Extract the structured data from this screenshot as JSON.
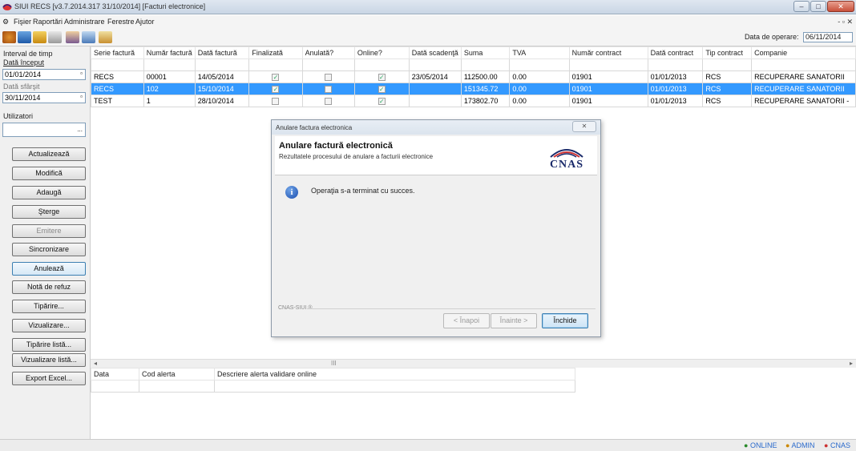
{
  "window": {
    "title": "SIUI RECS [v3.7.2014.317  31/10/2014]  [Facturi electronice]",
    "min": "–",
    "max": "□",
    "close": "✕"
  },
  "menu": {
    "items": [
      "Fişier",
      "Raportări",
      "Administrare",
      "Ferestre",
      "Ajutor"
    ],
    "mdi": "- ▫ ✕"
  },
  "toolbar": {
    "op_label": "Data de operare:",
    "op_value": "06/11/2014"
  },
  "filters": {
    "interval_label": "Interval de timp",
    "start_label": "Dată început",
    "start_value": "01/01/2014",
    "end_label": "Dată sfârşit",
    "end_value": "30/11/2014",
    "users_label": "Utilizatori",
    "dd": "▫",
    "more": "..."
  },
  "buttons": [
    "Actualizează",
    "Modifică",
    "Adaugă",
    "Şterge",
    "Emitere",
    "Sincronizare",
    "Anulează",
    "Notă de refuz",
    "Tipărire...",
    "Vizualizare...",
    "Tipărire listă...",
    "Vizualizare listă...",
    "Export Excel..."
  ],
  "table": {
    "headers": [
      "Serie factură",
      "Număr factură",
      "Dată factură",
      "Finalizată",
      "Anulată?",
      "Online?",
      "Dată scadenţă",
      "Suma",
      "TVA",
      "Număr contract",
      "Dată contract",
      "Tip contract",
      "Companie"
    ],
    "rows": [
      [
        "RECS",
        "00001",
        "14/05/2014",
        true,
        false,
        true,
        "23/05/2014",
        "112500.00",
        "0.00",
        "01901",
        "01/01/2013",
        "RCS",
        "RECUPERARE SANATORII"
      ],
      [
        "RECS",
        "102",
        "15/10/2014",
        true,
        false,
        true,
        "",
        "151345.72",
        "0.00",
        "01901",
        "01/01/2013",
        "RCS",
        "RECUPERARE SANATORII"
      ],
      [
        "TEST",
        "1",
        "28/10/2014",
        false,
        false,
        true,
        "",
        "173802.70",
        "0.00",
        "01901",
        "01/01/2013",
        "RCS",
        "RECUPERARE SANATORII -"
      ]
    ],
    "selected": 1
  },
  "alerts": {
    "headers": [
      "Data",
      "Cod alerta",
      "Descriere alerta validare online"
    ]
  },
  "scroll": {
    "left": "◂",
    "right": "▸",
    "thumb": "III"
  },
  "status": {
    "online": "ONLINE",
    "user": "ADMIN",
    "cnas": "CNAS"
  },
  "dialog": {
    "title": "Anulare factura electronica",
    "close": "✕",
    "heading": "Anulare factură electronică",
    "subtitle": "Rezultatele procesului de anulare a facturii electronice",
    "logo": "CNAS",
    "icon": "i",
    "message": "Operaţia s-a terminat cu succes.",
    "footer": "CNAS-SIUI ®",
    "back": "< Înapoi",
    "next": "Înainte >",
    "close_btn": "Închide"
  },
  "colors": {
    "selection": "#3399ff",
    "accent": "#3c7fb1"
  }
}
